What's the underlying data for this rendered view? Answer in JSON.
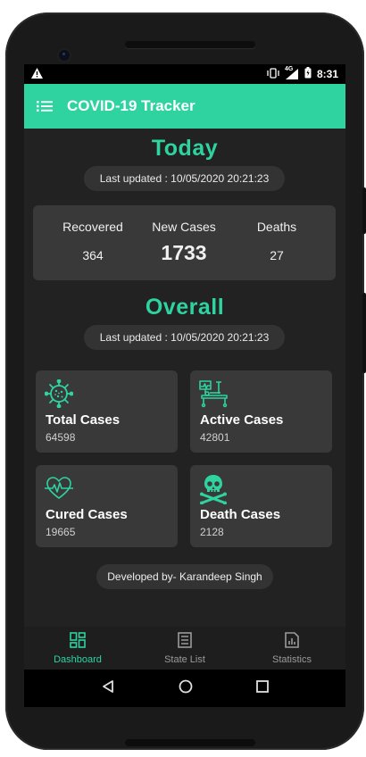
{
  "statusbar": {
    "time": "8:31",
    "network": "4G"
  },
  "appbar": {
    "title": "COVID-19 Tracker"
  },
  "today": {
    "heading": "Today",
    "last_updated": "Last updated : 10/05/2020 20:21:23",
    "recovered_label": "Recovered",
    "recovered_value": "364",
    "new_cases_label": "New Cases",
    "new_cases_value": "1733",
    "deaths_label": "Deaths",
    "deaths_value": "27"
  },
  "overall": {
    "heading": "Overall",
    "last_updated": "Last updated : 10/05/2020 20:21:23",
    "tiles": [
      {
        "title": "Total Cases",
        "value": "64598",
        "icon": "virus-icon"
      },
      {
        "title": "Active Cases",
        "value": "42801",
        "icon": "hospital-bed-icon"
      },
      {
        "title": "Cured Cases",
        "value": "19665",
        "icon": "heartbeat-icon"
      },
      {
        "title": "Death Cases",
        "value": "2128",
        "icon": "skull-crossbones-icon"
      }
    ]
  },
  "footer": {
    "developed_by": "Developed by- Karandeep Singh"
  },
  "bottom_nav": {
    "items": [
      {
        "label": "Dashboard",
        "icon": "dashboard-icon",
        "active": true
      },
      {
        "label": "State List",
        "icon": "list-document-icon",
        "active": false
      },
      {
        "label": "Statistics",
        "icon": "chart-icon",
        "active": false
      }
    ]
  },
  "colors": {
    "accent": "#2ed3a0",
    "background": "#222222",
    "card": "#393939"
  }
}
